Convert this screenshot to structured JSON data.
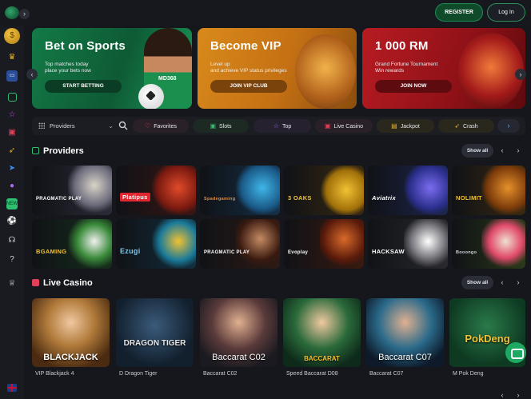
{
  "header": {
    "register_label": "REGISTER",
    "login_label": "Log In"
  },
  "banners": [
    {
      "title": "Bet on Sports",
      "line1": "Top matches today",
      "line2": "place your bets now",
      "cta": "START BETTING",
      "brand": "MD368"
    },
    {
      "title": "Become VIP",
      "line1": "Level up",
      "line2": "and achieve VIP status privileges",
      "cta": "JOIN VIP CLUB"
    },
    {
      "title": "1 000 RM",
      "line1": "Grand Fortune Tournament",
      "line2": "Win rewards",
      "cta": "JOIN NOW"
    }
  ],
  "filters": {
    "providers_label": "Providers",
    "pills": [
      {
        "label": "Favorites",
        "icon": "heart-icon",
        "color": "#e0405a"
      },
      {
        "label": "Slots",
        "icon": "slot-icon",
        "color": "#2fbf71"
      },
      {
        "label": "Top",
        "icon": "star-icon",
        "color": "#a86cf0"
      },
      {
        "label": "Live Casino",
        "icon": "live-icon",
        "color": "#e0405a"
      },
      {
        "label": "Jackpot",
        "icon": "jackpot-icon",
        "color": "#e5b12a"
      },
      {
        "label": "Crash",
        "icon": "crash-icon",
        "color": "#e5b12a"
      }
    ]
  },
  "providers": {
    "title": "Providers",
    "show_all": "Show all",
    "items": [
      "PRAGMATIC PLAY",
      "Platipus",
      "Spadegaming",
      "3 OAKS",
      "Aviatrix",
      "NOLIMIT",
      "BGAMING",
      "Ezugi",
      "PRAGMATIC PLAY",
      "Evoplay",
      "HACKSAW",
      "Booongo"
    ]
  },
  "live_casino": {
    "title": "Live Casino",
    "show_all": "Show all",
    "games": [
      {
        "caption": "BLACKJACK",
        "name": "VIP Blackjack 4"
      },
      {
        "caption": "DRAGON TIGER",
        "name": "D Dragon Tiger"
      },
      {
        "caption": "Baccarat C02",
        "name": "Baccarat C02"
      },
      {
        "caption": "BACCARAT",
        "name": "Speed Baccarat D08"
      },
      {
        "caption": "Baccarat C07",
        "name": "Baccarat C07"
      },
      {
        "caption": "PokDeng",
        "name": "M Pok Deng"
      }
    ]
  },
  "colors": {
    "accent_green": "#1f8a52",
    "background": "#15171c",
    "sidebar": "#191b21"
  }
}
